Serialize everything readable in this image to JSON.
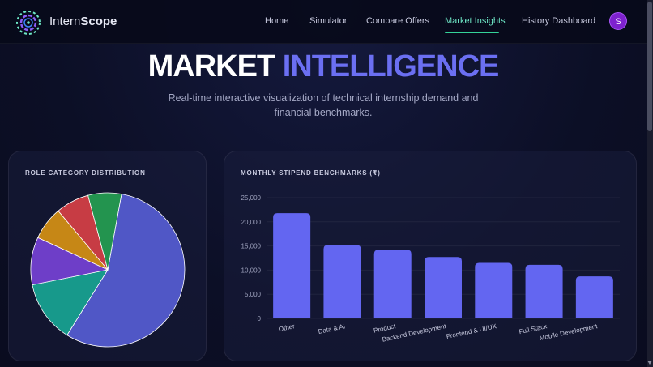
{
  "app": {
    "brand_light": "Intern",
    "brand_bold": "Scope"
  },
  "nav": {
    "items": [
      {
        "label": "Home"
      },
      {
        "label": "Simulator"
      },
      {
        "label": "Compare Offers"
      },
      {
        "label": "Market Insights",
        "active": true
      },
      {
        "label": "History Dashboard"
      }
    ],
    "avatar_initial": "S"
  },
  "hero": {
    "title_part1": "MARKET",
    "title_part2": "INTELLIGENCE",
    "subtitle": "Real-time interactive visualization of technical internship demand and financial benchmarks."
  },
  "colors": {
    "accent": "#6b6ff2",
    "active_nav": "#34d399",
    "bar": "#6366f1",
    "avatar": "#7e22ce"
  },
  "chart_data": [
    {
      "type": "pie",
      "title": "ROLE CATEGORY DISTRIBUTION",
      "slices": [
        {
          "value": 56,
          "color": "#5057c6"
        },
        {
          "value": 13,
          "color": "#17998b"
        },
        {
          "value": 10,
          "color": "#6e3ec8"
        },
        {
          "value": 7,
          "color": "#c68716"
        },
        {
          "value": 7,
          "color": "#c73c44"
        },
        {
          "value": 7,
          "color": "#23944f"
        }
      ]
    },
    {
      "type": "bar",
      "title": "MONTHLY STIPEND BENCHMARKS (₹)",
      "categories": [
        "Other",
        "Data & AI",
        "Product",
        "Backend Development",
        "Frontend & UI/UX",
        "Full Stack",
        "Mobile Development"
      ],
      "values": [
        21800,
        15200,
        14200,
        12700,
        11500,
        11100,
        8700
      ],
      "yticks": [
        "0",
        "5,000",
        "10,000",
        "15,000",
        "20,000",
        "25,000"
      ],
      "ylim": [
        0,
        25000
      ]
    }
  ]
}
